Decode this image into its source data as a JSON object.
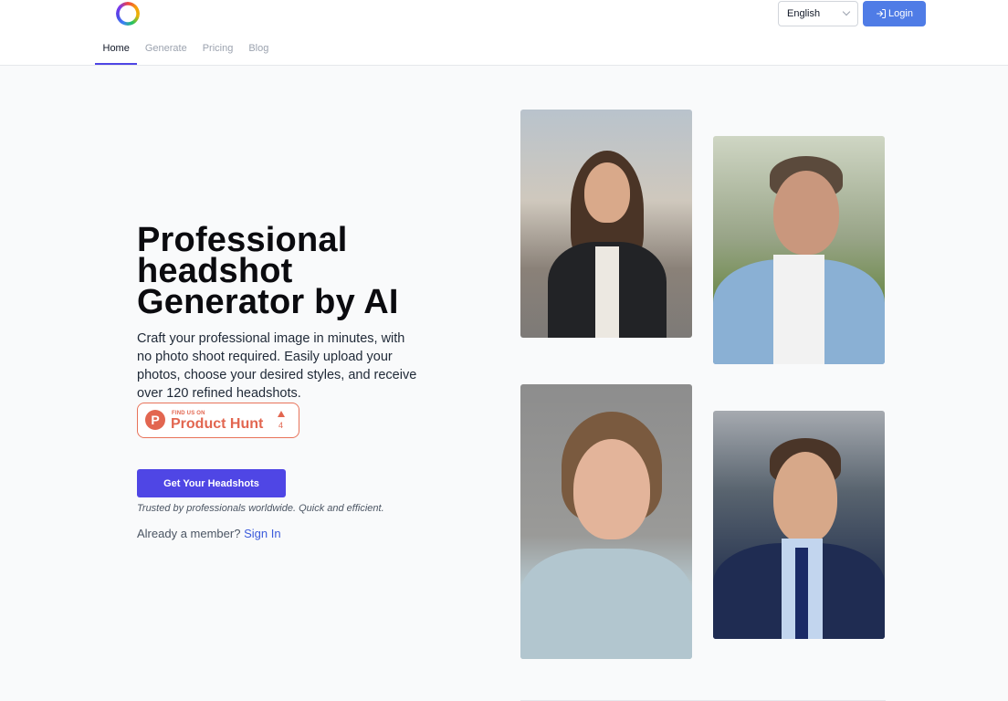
{
  "header": {
    "logo": "rainbow-ring-logo",
    "nav": [
      {
        "label": "Home",
        "active": true
      },
      {
        "label": "Generate",
        "active": false
      },
      {
        "label": "Pricing",
        "active": false
      },
      {
        "label": "Blog",
        "active": false
      }
    ],
    "language": {
      "selected": "English"
    },
    "login_label": "Login"
  },
  "hero": {
    "title_lines": [
      "Professional",
      "headshot",
      "Generator by AI"
    ],
    "description": "Craft your professional image in minutes, with no photo shoot required. Easily upload your photos, choose your desired styles, and receive over 120 refined headshots.",
    "product_hunt": {
      "letter": "P",
      "small_text": "FIND US ON",
      "big_text": "Product Hunt",
      "upvotes": "4"
    },
    "cta_label": "Get Your Headshots",
    "trusted_text": "Trusted by professionals worldwide. Quick and efficient.",
    "member_text": "Already a member?",
    "sign_in_label": "Sign In"
  },
  "gallery": [
    {
      "alt": "woman in black blazer, city street background"
    },
    {
      "alt": "man in light blue blazer, park background"
    },
    {
      "alt": "woman in light blue shirt, gray background"
    },
    {
      "alt": "man in navy suit and tie, office background"
    }
  ],
  "colors": {
    "accent": "#4f46e5",
    "login": "#4f7ce6",
    "product_hunt": "#e26650",
    "link": "#3b5bdb"
  }
}
